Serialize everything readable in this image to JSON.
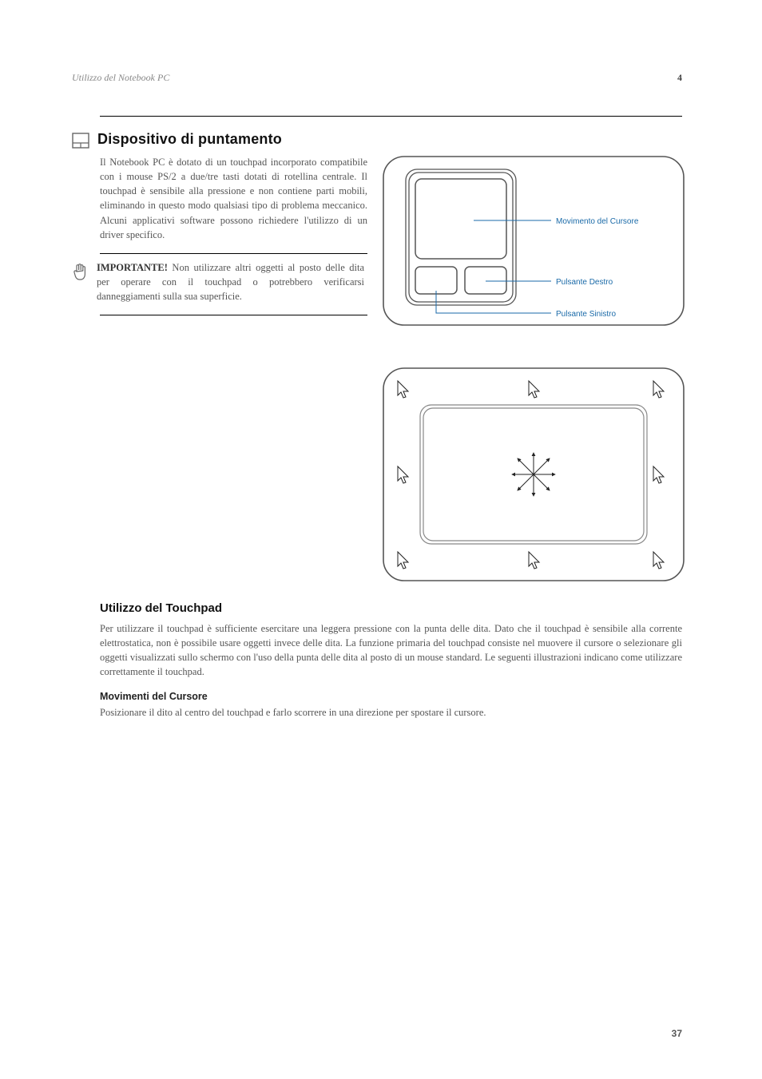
{
  "header": {
    "left": "Utilizzo del Notebook PC",
    "right": "4"
  },
  "section": {
    "title": "Dispositivo di puntamento",
    "intro": "Il Notebook PC è dotato di un touchpad incorporato compatibile con i mouse PS/2 a due/tre tasti dotati di rotellina centrale. Il touchpad è sensibile alla pressione e non contiene parti mobili, eliminando in questo modo qualsiasi tipo di problema meccanico. Alcuni applicativi software possono richiedere l'utilizzo di un driver specifico.",
    "note_label": "IMPORTANTE!",
    "note_body": " Non utilizzare altri oggetti al posto delle dita per operare con il touchpad o potrebbero verificarsi danneggiamenti sulla sua superficie."
  },
  "figure1_labels": {
    "movement": "Movimento del Cursore",
    "right": "Pulsante Destro",
    "left": "Pulsante Sinistro"
  },
  "usage": {
    "heading": "Utilizzo del Touchpad",
    "body": "Per utilizzare il touchpad è sufficiente esercitare una leggera pressione con la punta delle dita. Dato che il touchpad è sensibile alla corrente elettrostatica, non è possibile usare oggetti invece delle dita. La funzione primaria del touchpad consiste nel muovere il cursore o selezionare gli oggetti visualizzati sullo schermo con l'uso della punta delle dita al posto di un mouse standard. Le seguenti illustrazioni indicano come utilizzare correttamente il touchpad.",
    "move_heading": "Movimenti del Cursore",
    "move_body": "Posizionare il dito al centro del touchpad e farlo scorrere in una direzione per spostare il cursore."
  },
  "page_number": "37"
}
